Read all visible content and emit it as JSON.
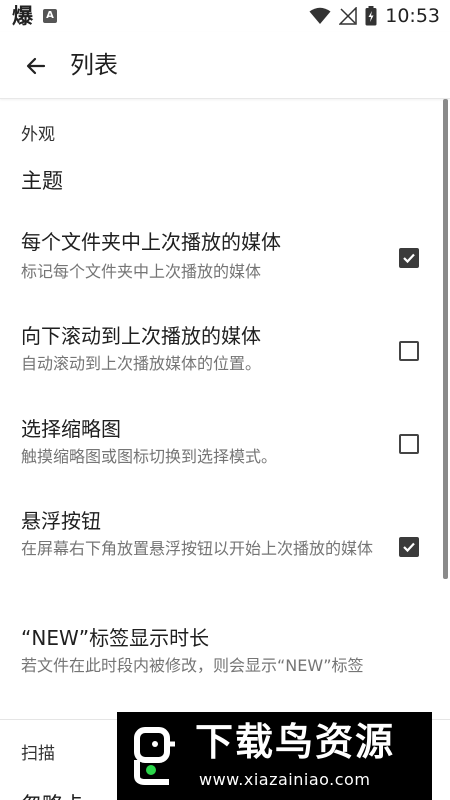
{
  "status_bar": {
    "left_glyph": "爆",
    "a_badge": "A",
    "time": "10:53"
  },
  "toolbar": {
    "title": "列表"
  },
  "sections": {
    "appearance_header": "外观",
    "theme_label": "主题",
    "scan_header": "扫描",
    "cutoff_label": "忽略卡"
  },
  "prefs": [
    {
      "title": "每个文件夹中上次播放的媒体",
      "summary": "标记每个文件夹中上次播放的媒体",
      "checked": true
    },
    {
      "title": "向下滚动到上次播放的媒体",
      "summary": "自动滚动到上次播放媒体的位置。",
      "checked": false
    },
    {
      "title": "选择缩略图",
      "summary": "触摸缩略图或图标切换到选择模式。",
      "checked": false
    },
    {
      "title": "悬浮按钮",
      "summary": "在屏幕右下角放置悬浮按钮以开始上次播放的媒体",
      "checked": true
    },
    {
      "title": "“NEW”标签显示时长",
      "summary": "若文件在此时段内被修改，则会显示“NEW”标签",
      "checked": null
    }
  ],
  "watermark": {
    "brand": "下载鸟资源",
    "url": "www.xiazainiao.com"
  },
  "colors": {
    "checkbox_checked": "#3b3b3b",
    "summary_text": "#757575",
    "scrollbar": "#8a8a8a"
  }
}
